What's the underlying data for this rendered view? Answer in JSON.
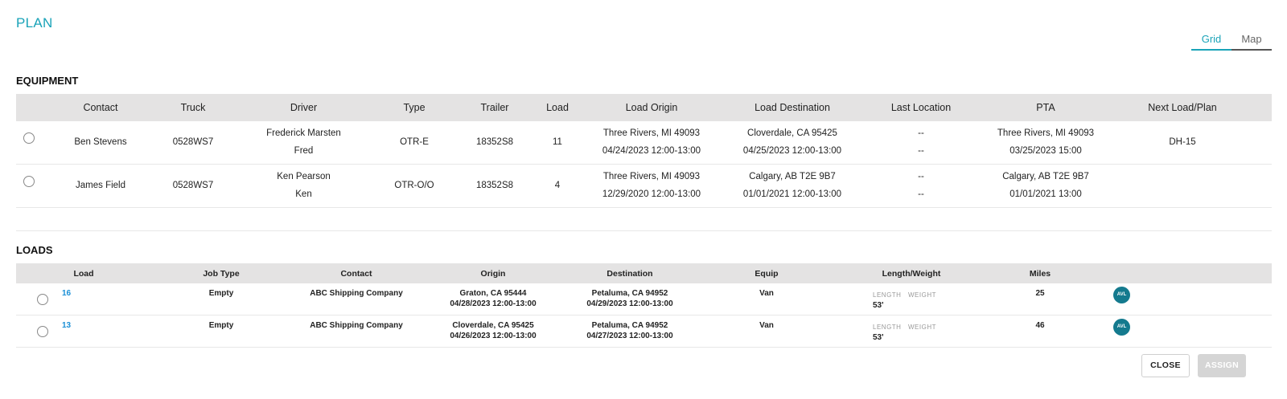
{
  "title": "PLAN",
  "view_toggle": {
    "grid": "Grid",
    "map": "Map",
    "active": "Grid"
  },
  "accent_color": "#1aa3b8",
  "equipment": {
    "title": "EQUIPMENT",
    "headers": [
      "Contact",
      "Truck",
      "Driver",
      "Type",
      "Trailer",
      "Load",
      "Load Origin",
      "Load Destination",
      "Last Location",
      "PTA",
      "Next Load/Plan"
    ],
    "rows": [
      {
        "contact": "Ben Stevens",
        "truck": "0528WS7",
        "driver_1": "Frederick Marsten",
        "driver_2": "Fred",
        "type": "OTR-E",
        "trailer": "18352S8",
        "load": "11",
        "origin_1": "Three Rivers, MI 49093",
        "origin_2": "04/24/2023 12:00-13:00",
        "dest_1": "Cloverdale, CA 95425",
        "dest_2": "04/25/2023 12:00-13:00",
        "last_1": "--",
        "last_2": "--",
        "pta_1": "Three Rivers, MI 49093",
        "pta_2": "03/25/2023 15:00",
        "next": "DH-15"
      },
      {
        "contact": "James Field",
        "truck": "0528WS7",
        "driver_1": "Ken Pearson",
        "driver_2": "Ken",
        "type": "OTR-O/O",
        "trailer": "18352S8",
        "load": "4",
        "origin_1": "Three Rivers, MI 49093",
        "origin_2": "12/29/2020 12:00-13:00",
        "dest_1": "Calgary, AB T2E 9B7",
        "dest_2": "01/01/2021 12:00-13:00",
        "last_1": "--",
        "last_2": "--",
        "pta_1": "Calgary, AB T2E 9B7",
        "pta_2": "01/01/2021 13:00",
        "next": ""
      }
    ]
  },
  "loads": {
    "title": "LOADS",
    "headers": [
      "Load",
      "Job Type",
      "Contact",
      "Origin",
      "Destination",
      "Equip",
      "Length/Weight",
      "Miles"
    ],
    "rows": [
      {
        "load": "16",
        "job_type": "Empty",
        "contact": "ABC Shipping Company",
        "origin_1": "Graton, CA 95444",
        "origin_2": "04/28/2023 12:00-13:00",
        "dest_1": "Petaluma, CA 94952",
        "dest_2": "04/29/2023 12:00-13:00",
        "equip": "Van",
        "length_label": "LENGTH",
        "weight_label": "WEIGHT",
        "length": "53'",
        "miles": "25",
        "badge": "AVL"
      },
      {
        "load": "13",
        "job_type": "Empty",
        "contact": "ABC Shipping Company",
        "origin_1": "Cloverdale, CA 95425",
        "origin_2": "04/26/2023 12:00-13:00",
        "dest_1": "Petaluma, CA 94952",
        "dest_2": "04/27/2023 12:00-13:00",
        "equip": "Van",
        "length_label": "LENGTH",
        "weight_label": "WEIGHT",
        "length": "53'",
        "miles": "46",
        "badge": "AVL"
      }
    ]
  },
  "buttons": {
    "close": "CLOSE",
    "assign": "ASSIGN"
  }
}
